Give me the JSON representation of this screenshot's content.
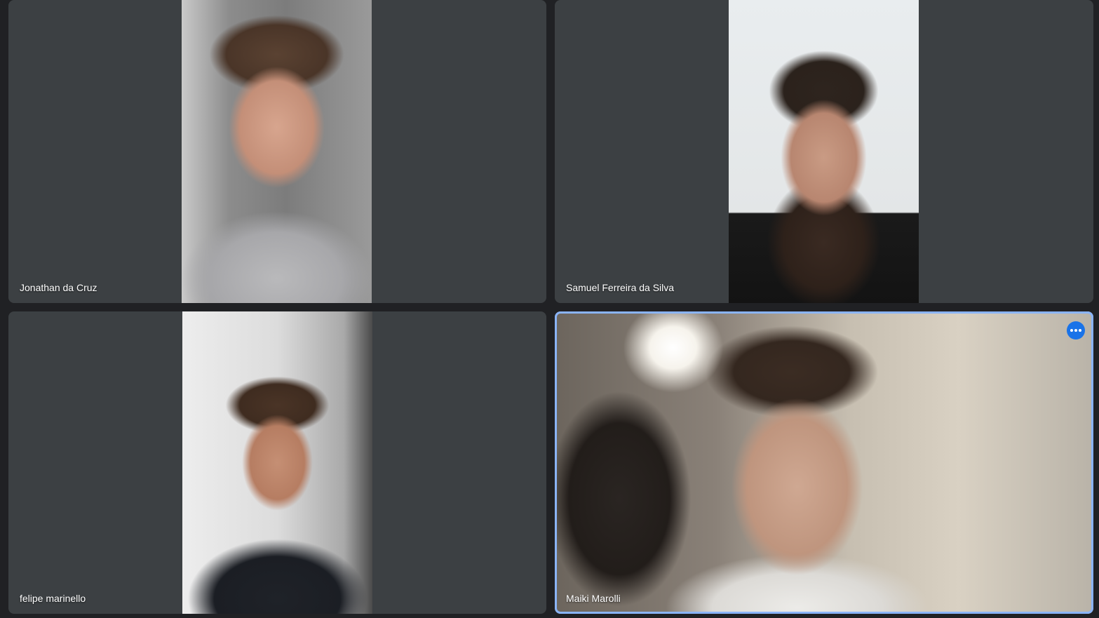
{
  "participants": [
    {
      "name": "Jonathan da Cruz"
    },
    {
      "name": "Samuel Ferreira da Silva"
    },
    {
      "name": "felipe marinello"
    },
    {
      "name": "Maiki Marolli"
    }
  ],
  "icons": {
    "more_options": "more-horizontal-icon"
  },
  "colors": {
    "tile_background": "#3c4043",
    "page_background": "#202124",
    "active_speaker_ring": "#8ab4f8",
    "more_button": "#1a73e8"
  }
}
